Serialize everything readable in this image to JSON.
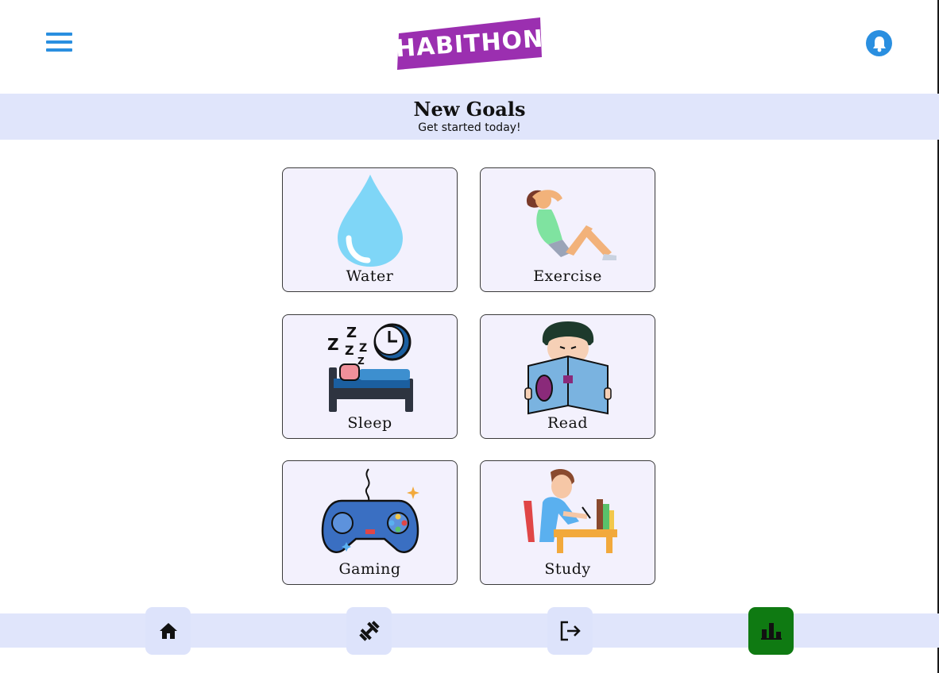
{
  "header": {
    "logo_text": "HABITHON",
    "brand_color": "#9b2fb0",
    "accent_color": "#2a8fe0"
  },
  "banner": {
    "title": "New Goals",
    "subtitle": "Get started today!"
  },
  "goals": [
    {
      "label": "Water",
      "icon": "water-drop-icon"
    },
    {
      "label": "Exercise",
      "icon": "exercise-situp-icon"
    },
    {
      "label": "Sleep",
      "icon": "sleep-bed-icon"
    },
    {
      "label": "Read",
      "icon": "read-book-icon"
    },
    {
      "label": "Gaming",
      "icon": "gamepad-icon"
    },
    {
      "label": "Study",
      "icon": "study-desk-icon"
    }
  ],
  "nav": [
    {
      "icon": "home-icon",
      "active": false
    },
    {
      "icon": "dumbbell-icon",
      "active": false
    },
    {
      "icon": "logout-icon",
      "active": false
    },
    {
      "icon": "bar-chart-icon",
      "active": true
    }
  ],
  "colors": {
    "banner_bg": "#e0e5fb",
    "card_bg": "#f3f1fd",
    "active_nav": "#0f7a12"
  }
}
